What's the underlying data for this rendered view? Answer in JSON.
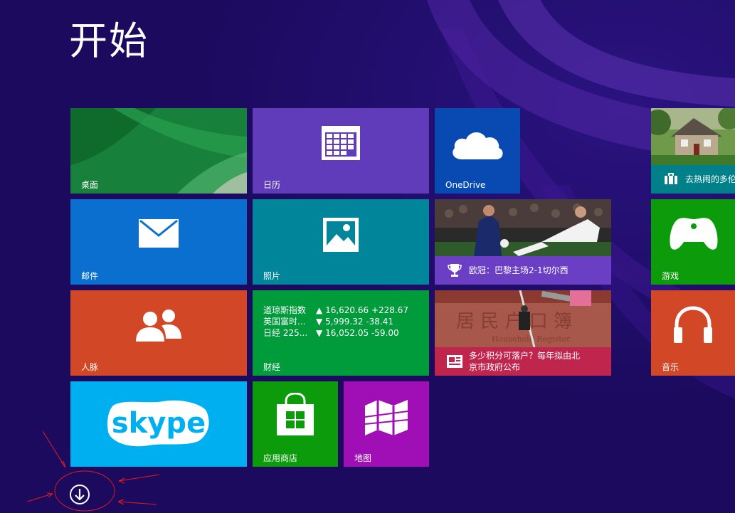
{
  "screen": {
    "title": "开始"
  },
  "tiles": {
    "desktop": {
      "label": "桌面",
      "color": "#1f8a3c"
    },
    "calendar": {
      "label": "日历",
      "color": "#603cba"
    },
    "onedrive": {
      "label": "OneDrive",
      "color": "#094ab2"
    },
    "travel": {
      "label": "去热闹的多伦",
      "color": "#00818a"
    },
    "mail": {
      "label": "邮件",
      "color": "#0a6fcf"
    },
    "photos": {
      "label": "照片",
      "color": "#00859b"
    },
    "sports": {
      "label": "欧冠：巴黎主场2-1切尔西",
      "color": "#6a3fc4"
    },
    "games": {
      "label": "游戏",
      "color": "#0b9b0b"
    },
    "people": {
      "label": "人脉",
      "color": "#d24726"
    },
    "finance": {
      "label": "财经",
      "color": "#009b3a",
      "rows": [
        {
          "name": "道琼斯指数",
          "arrow": "▲",
          "value": "16,620.66",
          "change": "+228.67"
        },
        {
          "name": "英国富时...",
          "arrow": "▼",
          "value": "5,999.32",
          "change": "-38.41"
        },
        {
          "name": "日经 225...",
          "arrow": "▼",
          "value": "16,052.05",
          "change": "-59.00"
        }
      ]
    },
    "news": {
      "label_line1": "多少积分可落户？每年拟由北",
      "label_line2": "京市政府公布",
      "photo_text_top": "居 民 户 口 簿",
      "photo_text_bottom": "Household Register",
      "color": "#c0254d"
    },
    "music": {
      "label": "音乐",
      "color": "#d24726"
    },
    "skype": {
      "label": "skype",
      "color": "#00aff0"
    },
    "store": {
      "label": "应用商店",
      "color": "#0b9b0b"
    },
    "maps": {
      "label": "地图",
      "color": "#a00fb5"
    }
  },
  "scroll_button": {
    "icon": "arrow-down-circle-icon"
  },
  "annotation": {
    "color": "#e41b1b"
  }
}
